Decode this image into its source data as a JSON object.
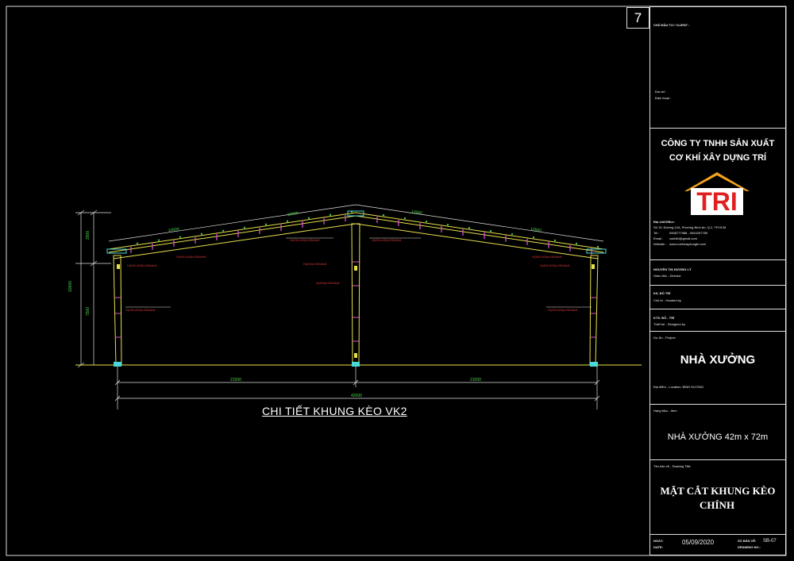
{
  "sheet": {
    "page_number": "7",
    "drawing_caption": "CHI TIẾT KHUNG KÈO VK2"
  },
  "drawing": {
    "dimensions": {
      "span_total": "42000",
      "span_left": "21000",
      "span_right": "21000",
      "height_total": "10000",
      "height_eave": "7500",
      "height_roof": "2500",
      "rafter_seg_1": "10500",
      "rafter_seg_2": "10000",
      "rafter_seg_3": "10000",
      "rafter_seg_4": "10500"
    },
    "labels": {
      "rafter_left": "H(200-400)x150x5x8",
      "rafter_right": "H(200-400)x150x5x8",
      "haunch_left": "H(300-600)x150x6x8",
      "haunch_right": "H(300-600)x150x6x8",
      "column_left_top": "H(400-600)x150x6x8",
      "column_right_top": "H(400-600)x150x6x8",
      "column_left": "H(200-600)x150x6x8",
      "column_right": "H(200-600)x150x6x8",
      "center_col_1": "H(400)x150x6x8",
      "center_col_2": "H(400)x150x6x8"
    },
    "colors": {
      "frame": "#e8e04a",
      "dimension": "#e0e0e0",
      "text_dim": "#4cd94c",
      "labels": "#d93a3a",
      "purlin": "#d64fd6",
      "ground": "#e8e04a",
      "cyan": "#4ad9d9"
    }
  },
  "title_block": {
    "client_label": "CHỦ ĐẦU TƯ / CLIENT :",
    "address_label": "Địa chỉ :",
    "phone_label": "Điện thoại :",
    "company_line1": "CÔNG TY TNHH SẢN XUẤT",
    "company_line2": "CƠ KHÍ XÂY DỰNG TRÍ",
    "logo_text": "TRI",
    "office_label": "Địa chỉ/Office:",
    "office_address": "Số 15, Đường 12A, Phường Bình An, Q.2, TP.HCM",
    "tel_label": "Tel :",
    "tel_value": "0908777988 - 0944297789",
    "email_label": "Email :",
    "email_value": "cokhitri@gmail.com",
    "web_label": "Website :",
    "web_value": "www.cokhixaydungtri.com",
    "director_label": "NGUYỄN THỊ HƯƠNG LÝ",
    "director_role": "Giám đốc - Director",
    "designer_label": "KS. ĐỖ TRÍ",
    "designer_role": "Chủ trì - Headed by",
    "drafter_label": "KTS. ĐỖ - TRÍ",
    "drafter_role": "Thiết kế - Designed by",
    "project_label": "Dự Án - Project",
    "project_name": "NHÀ XƯỞNG",
    "location_label": "Địa điểm - Location: BÌNH DƯƠNG",
    "item_label": "Hạng Mục - Item",
    "item_name": "NHÀ XƯỞNG 42m x 72m",
    "sheet_title_label": "Tên bản vẽ - Drawing Title",
    "sheet_title_line1": "MẶT CẮT KHUNG KÈO",
    "sheet_title_line2": "CHÍNH",
    "date_label": "NGÀY:",
    "date_label_en": "DATE:",
    "date_value": "05/09/2020",
    "drawing_no_label": "SỐ BẢN VẼ:",
    "drawing_no_label_en": "DRAWING NO.:",
    "drawing_no_value": "SB-07"
  }
}
